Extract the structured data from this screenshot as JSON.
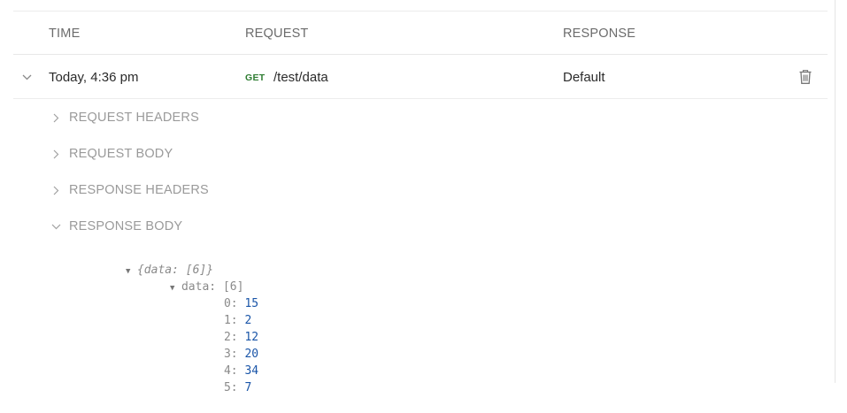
{
  "columns": {
    "time": "TIME",
    "request": "REQUEST",
    "response": "RESPONSE"
  },
  "entry": {
    "time": "Today, 4:36 pm",
    "method": "GET",
    "path": "/test/data",
    "response": "Default"
  },
  "sections": {
    "request_headers": "REQUEST HEADERS",
    "request_body": "REQUEST BODY",
    "response_headers": "RESPONSE HEADERS",
    "response_body": "RESPONSE BODY"
  },
  "json_viewer": {
    "root_preview": "{data: [6]}",
    "data_key": "data:",
    "data_count": "[6]",
    "items": [
      {
        "index": "0:",
        "value": "15"
      },
      {
        "index": "1:",
        "value": "2"
      },
      {
        "index": "2:",
        "value": "12"
      },
      {
        "index": "3:",
        "value": "20"
      },
      {
        "index": "4:",
        "value": "34"
      },
      {
        "index": "5:",
        "value": "7"
      }
    ]
  },
  "colors": {
    "method_get": "#2e7d32",
    "json_number": "#1a55a8",
    "muted_text": "#9a9a9a"
  }
}
